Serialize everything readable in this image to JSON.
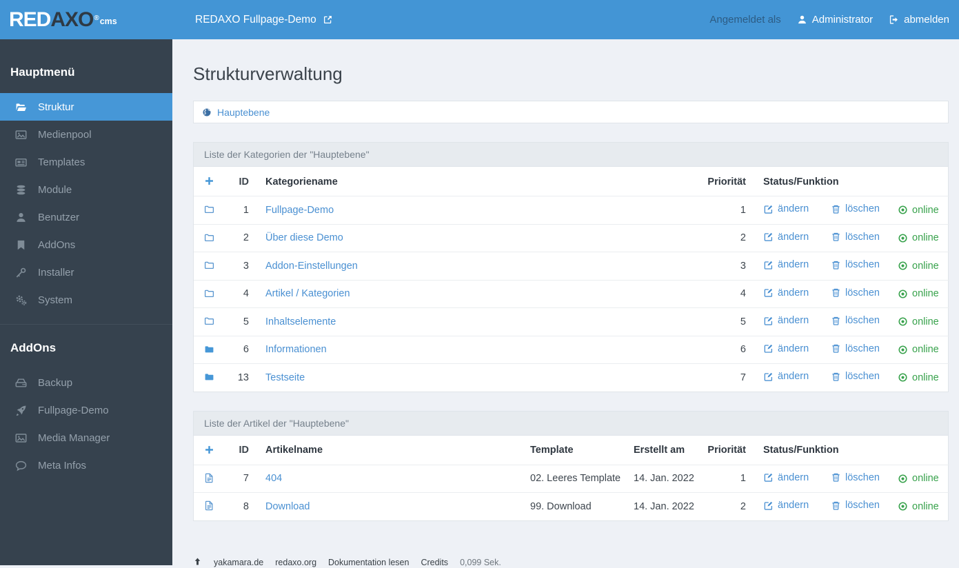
{
  "colors": {
    "header_blue": "#4395d5",
    "accent_blue": "#4697d7",
    "link_blue": "#4a90d2",
    "online_green": "#38a24c",
    "sidebar_bg": "#36424e"
  },
  "header": {
    "brand": {
      "red": "RED",
      "axo": "AXO",
      "registered": "®",
      "cms": "cms"
    },
    "site_link": {
      "label": "REDAXO Fullpage-Demo",
      "icon": "external-link-icon"
    },
    "logged_in_as": "Angemeldet als",
    "user": {
      "label": "Administrator",
      "icon": "user-icon"
    },
    "logout": {
      "label": "abmelden",
      "icon": "sign-out-icon"
    }
  },
  "sidebar": {
    "sections": [
      {
        "title": "Hauptmenü",
        "items": [
          {
            "label": "Struktur",
            "icon": "folder-open-icon",
            "active": true
          },
          {
            "label": "Medienpool",
            "icon": "image-icon",
            "active": false
          },
          {
            "label": "Templates",
            "icon": "newspaper-icon",
            "active": false
          },
          {
            "label": "Module",
            "icon": "database-icon",
            "active": false
          },
          {
            "label": "Benutzer",
            "icon": "user-icon",
            "active": false
          },
          {
            "label": "AddOns",
            "icon": "bookmark-icon",
            "active": false
          },
          {
            "label": "Installer",
            "icon": "key-icon",
            "active": false
          },
          {
            "label": "System",
            "icon": "gears-icon",
            "active": false
          }
        ]
      },
      {
        "title": "AddOns",
        "items": [
          {
            "label": "Backup",
            "icon": "hdd-icon",
            "active": false
          },
          {
            "label": "Fullpage-Demo",
            "icon": "rocket-icon",
            "active": false
          },
          {
            "label": "Media Manager",
            "icon": "image-icon",
            "active": false
          },
          {
            "label": "Meta Infos",
            "icon": "comment-icon",
            "active": false
          }
        ]
      }
    ]
  },
  "main": {
    "title": "Strukturverwaltung",
    "breadcrumb": {
      "label": "Hauptebene",
      "icon": "globe-icon"
    },
    "actions": {
      "add_icon": "plus-icon",
      "edit": "ändern",
      "delete": "löschen",
      "online": "online"
    },
    "categories": {
      "panel_title": "Liste der Kategorien der \"Hauptebene\"",
      "columns": {
        "id": "ID",
        "name": "Kategoriename",
        "priority": "Priorität",
        "status": "Status/Funktion"
      },
      "rows": [
        {
          "id": "1",
          "name": "Fullpage-Demo",
          "priority": "1",
          "icon": "folder-outline-icon",
          "status": "online"
        },
        {
          "id": "2",
          "name": "Über diese Demo",
          "priority": "2",
          "icon": "folder-outline-icon",
          "status": "online"
        },
        {
          "id": "3",
          "name": "Addon-Einstellungen",
          "priority": "3",
          "icon": "folder-outline-icon",
          "status": "online"
        },
        {
          "id": "4",
          "name": "Artikel / Kategorien",
          "priority": "4",
          "icon": "folder-outline-icon",
          "status": "online"
        },
        {
          "id": "5",
          "name": "Inhaltselemente",
          "priority": "5",
          "icon": "folder-outline-icon",
          "status": "online"
        },
        {
          "id": "6",
          "name": "Informationen",
          "priority": "6",
          "icon": "folder-solid-icon",
          "status": "online"
        },
        {
          "id": "13",
          "name": "Testseite",
          "priority": "7",
          "icon": "folder-solid-icon",
          "status": "online"
        }
      ]
    },
    "articles": {
      "panel_title": "Liste der Artikel der \"Hauptebene\"",
      "columns": {
        "id": "ID",
        "name": "Artikelname",
        "template": "Template",
        "created": "Erstellt am",
        "priority": "Priorität",
        "status": "Status/Funktion"
      },
      "rows": [
        {
          "id": "7",
          "name": "404",
          "template": "02. Leeres Template",
          "created": "14. Jan. 2022",
          "priority": "1",
          "icon": "file-icon",
          "status": "online"
        },
        {
          "id": "8",
          "name": "Download",
          "template": "99. Download",
          "created": "14. Jan. 2022",
          "priority": "2",
          "icon": "file-icon",
          "status": "online"
        }
      ]
    }
  },
  "footer": {
    "top_icon": "arrow-up-icon",
    "links": [
      "yakamara.de",
      "redaxo.org",
      "Dokumentation lesen",
      "Credits"
    ],
    "duration": "0,099 Sek."
  }
}
